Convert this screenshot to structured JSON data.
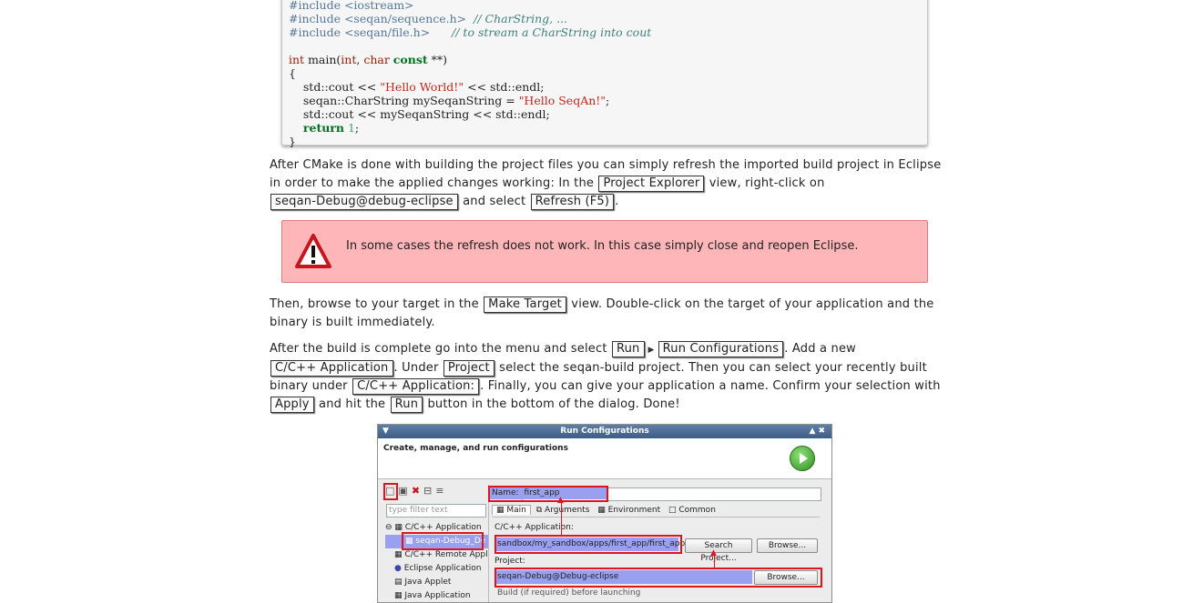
{
  "code": {
    "line0": "#include <iostream>",
    "inc1": "#include <seqan/sequence.h>",
    "cm1": "// CharString, ...",
    "inc2": "#include <seqan/file.h>",
    "cm2": "// to stream a CharString into cout",
    "main_int": "int",
    "main_name": "main(",
    "main_int2": "int",
    "main_char": "char",
    "main_const": "const",
    "main_tail": "**)",
    "brace_open": "{",
    "l1a": "    std::cout << ",
    "l1s": "\"Hello World!\"",
    "l1b": " << std::endl;",
    "l2a": "    seqan::CharString mySeqanString = ",
    "l2s": "\"Hello SeqAn!\"",
    "l2b": ";",
    "l3": "    std::cout << mySeqanString << std::endl;",
    "l4k": "return",
    "l4n": "1",
    "brace_close": "}"
  },
  "para1": {
    "t1": "After CMake is done with building the project files you can simply refresh the imported build project in Eclipse in order to make the applied changes working: In the",
    "gui1": "Project Explorer",
    "t2": "view, right-click on",
    "gui2": "seqan-Debug@debug-eclipse",
    "t3": "and select",
    "gui3": "Refresh (F5)",
    "t4": "."
  },
  "warning": {
    "text": "In some cases the refresh does not work. In this case simply close and reopen Eclipse."
  },
  "para2": {
    "t1": "Then, browse to your target in the",
    "gui1": "Make Target",
    "t2": "view. Double-click on the target of your application and the binary is built immediately."
  },
  "para3": {
    "t1": "After the build is complete go into the menu and select",
    "gui1": "Run",
    "gui2": "Run Configurations",
    "t2": ". Add a new",
    "gui3": "C/C++ Application",
    "t3": ". Under",
    "gui4": "Project",
    "t4": "select the seqan-build project. Then you can select your recently built binary under",
    "gui5": "C/C++ Application:",
    "t5": ". Finally, you can give your application a name. Confirm your selection with",
    "gui6": "Apply",
    "t6": "and hit the",
    "gui7": "Run",
    "t7": "button in the bottom of the dialog. Done!"
  },
  "dialog": {
    "title": "Run Configurations",
    "header": "Create, manage, and run configurations",
    "filter_placeholder": "type filter text",
    "tree": [
      "C/C++ Application",
      "seqan-Debug_De",
      "C/C++ Remote Appl",
      "Eclipse Application",
      "Java Applet",
      "Java Application"
    ],
    "name_label": "Name:",
    "name_value": "first_app",
    "tabs": [
      "Main",
      "Arguments",
      "Environment",
      "Common"
    ],
    "app_label": "C/C++ Application:",
    "app_value": "sandbox/my_sandbox/apps/first_app/first_app",
    "search_button": "Search Project...",
    "browse_button": "Browse...",
    "project_label": "Project:",
    "project_value": "seqan-Debug@Debug-eclipse",
    "browse_button2": "Browse...",
    "build_label": "Build (if required) before launching"
  }
}
